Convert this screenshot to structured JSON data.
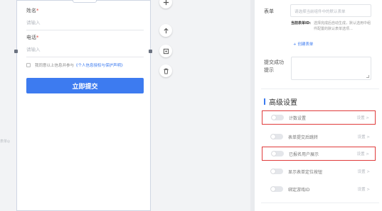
{
  "form": {
    "fields": [
      {
        "label": "姓名",
        "required_mark": "*",
        "placeholder": "请输入"
      },
      {
        "label": "电话",
        "required_mark": "*",
        "placeholder": "请输入"
      }
    ],
    "consent_text": "我同意以上信息并参与",
    "consent_link": "《个人信息授权与保护声明》",
    "submit_label": "立即提交",
    "side_label": "表单◎"
  },
  "tools": {
    "add_icon": "plus-icon",
    "move_up_icon": "arrow-up-icon",
    "copy_icon": "copy-icon",
    "delete_icon": "trash-icon"
  },
  "panel": {
    "form_label": "表单",
    "form_select_placeholder": "请选择当前组件中的默认表单",
    "current_form_key": "当前表单ID:",
    "current_form_desc": "选择完成后自动生成，默认选用中组件配置的默认表单选项...",
    "add_form": "+ 创建表单",
    "success_label_line1": "提交成功",
    "success_label_line2": "提示",
    "advanced_title": "高级设置",
    "settings": [
      {
        "name": "计数设置",
        "link": "设置 >",
        "highlighted": true
      },
      {
        "name": "表单提交后跳转",
        "link": "设置 >",
        "highlighted": false
      },
      {
        "name": "已报名用户展示",
        "link": "设置 >",
        "highlighted": true
      },
      {
        "name": "显示表单定位按钮",
        "link": "设置 >",
        "highlighted": false
      },
      {
        "name": "绑定游戏ID",
        "link": "设置 >",
        "highlighted": false
      }
    ]
  },
  "colors": {
    "accent": "#3d7bf0",
    "highlight": "#e03b3b",
    "required": "#e0493e"
  }
}
